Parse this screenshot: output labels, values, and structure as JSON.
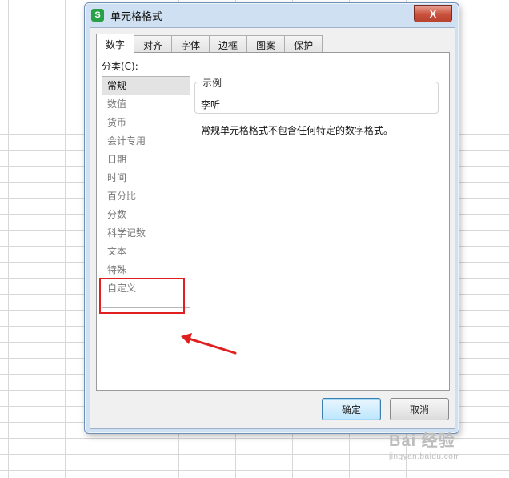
{
  "window": {
    "title": "单元格格式",
    "app_icon_letter": "S",
    "close_glyph": "X"
  },
  "tabs": [
    {
      "label": "数字",
      "active": true
    },
    {
      "label": "对齐",
      "active": false
    },
    {
      "label": "字体",
      "active": false
    },
    {
      "label": "边框",
      "active": false
    },
    {
      "label": "图案",
      "active": false
    },
    {
      "label": "保护",
      "active": false
    }
  ],
  "category": {
    "label": "分类(C):",
    "items": [
      "常规",
      "数值",
      "货币",
      "会计专用",
      "日期",
      "时间",
      "百分比",
      "分数",
      "科学记数",
      "文本",
      "特殊",
      "自定义"
    ],
    "selected_index": 0
  },
  "sample": {
    "legend": "示例",
    "value": "李听"
  },
  "description": "常规单元格格式不包含任何特定的数字格式。",
  "buttons": {
    "ok": "确定",
    "cancel": "取消"
  },
  "annotation": {
    "color": "#e02020",
    "highlight_target": "自定义"
  },
  "watermark": {
    "main": "Bai 经验",
    "sub": "jingyan.baidu.com"
  }
}
